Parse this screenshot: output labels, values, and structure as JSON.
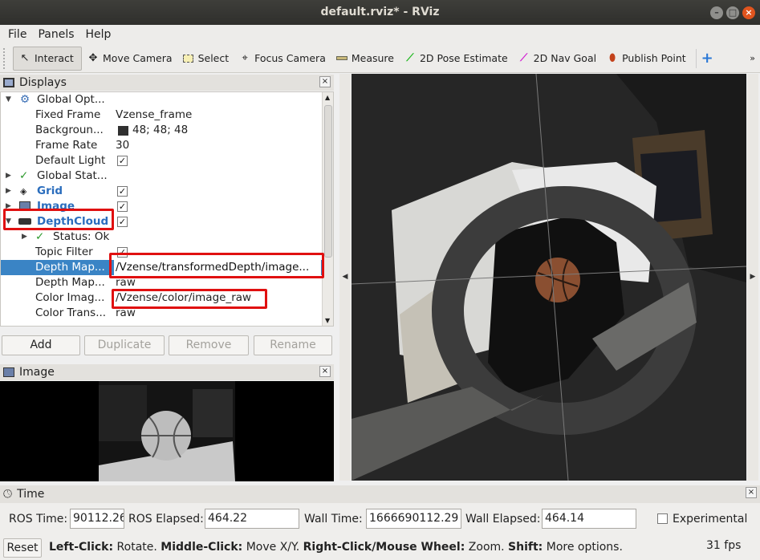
{
  "window": {
    "title": "default.rviz* - RViz"
  },
  "menu": [
    "File",
    "Panels",
    "Help"
  ],
  "toolbar": {
    "interact": "Interact",
    "move_camera": "Move Camera",
    "select": "Select",
    "focus_camera": "Focus Camera",
    "measure": "Measure",
    "pose_estimate": "2D Pose Estimate",
    "nav_goal": "2D Nav Goal",
    "publish_point": "Publish Point"
  },
  "displays": {
    "title": "Displays",
    "rows": [
      {
        "label": "Global Opt...",
        "value": ""
      },
      {
        "label": "Fixed Frame",
        "value": "Vzense_frame"
      },
      {
        "label": "Backgroun...",
        "value": "48; 48; 48"
      },
      {
        "label": "Frame Rate",
        "value": "30"
      },
      {
        "label": "Default Light",
        "value": ""
      },
      {
        "label": "Global Stat...",
        "value": ""
      },
      {
        "label": "Grid",
        "value": ""
      },
      {
        "label": "Image",
        "value": ""
      },
      {
        "label": "DepthCloud",
        "value": ""
      },
      {
        "label": "Status: Ok",
        "value": ""
      },
      {
        "label": "Topic Filter",
        "value": ""
      },
      {
        "label": "Depth Map...",
        "value": "/Vzense/transformedDepth/image..."
      },
      {
        "label": "Depth Map...",
        "value": "raw"
      },
      {
        "label": "Color Imag...",
        "value": "/Vzense/color/image_raw"
      },
      {
        "label": "Color Trans...",
        "value": "raw"
      }
    ],
    "buttons": {
      "add": "Add",
      "duplicate": "Duplicate",
      "remove": "Remove",
      "rename": "Rename"
    }
  },
  "image_panel": {
    "title": "Image"
  },
  "time": {
    "title": "Time",
    "ros_time_label": "ROS Time:",
    "ros_time": "90112.26",
    "ros_elapsed_label": "ROS Elapsed:",
    "ros_elapsed": "464.22",
    "wall_time_label": "Wall Time:",
    "wall_time": "1666690112.29",
    "wall_elapsed_label": "Wall Elapsed:",
    "wall_elapsed": "464.14",
    "experimental": "Experimental"
  },
  "status": {
    "reset": "Reset",
    "left_click": "Left-Click:",
    "left_click_desc": "Rotate.",
    "middle_click": "Middle-Click:",
    "middle_click_desc": "Move X/Y.",
    "right_click": "Right-Click/Mouse Wheel:",
    "right_click_desc": "Zoom.",
    "shift": "Shift:",
    "shift_desc": "More options.",
    "fps": "31 fps"
  },
  "colors": {
    "selection": "#3a84c5",
    "highlight_box": "#e01010",
    "background_swatch": "#303030"
  }
}
